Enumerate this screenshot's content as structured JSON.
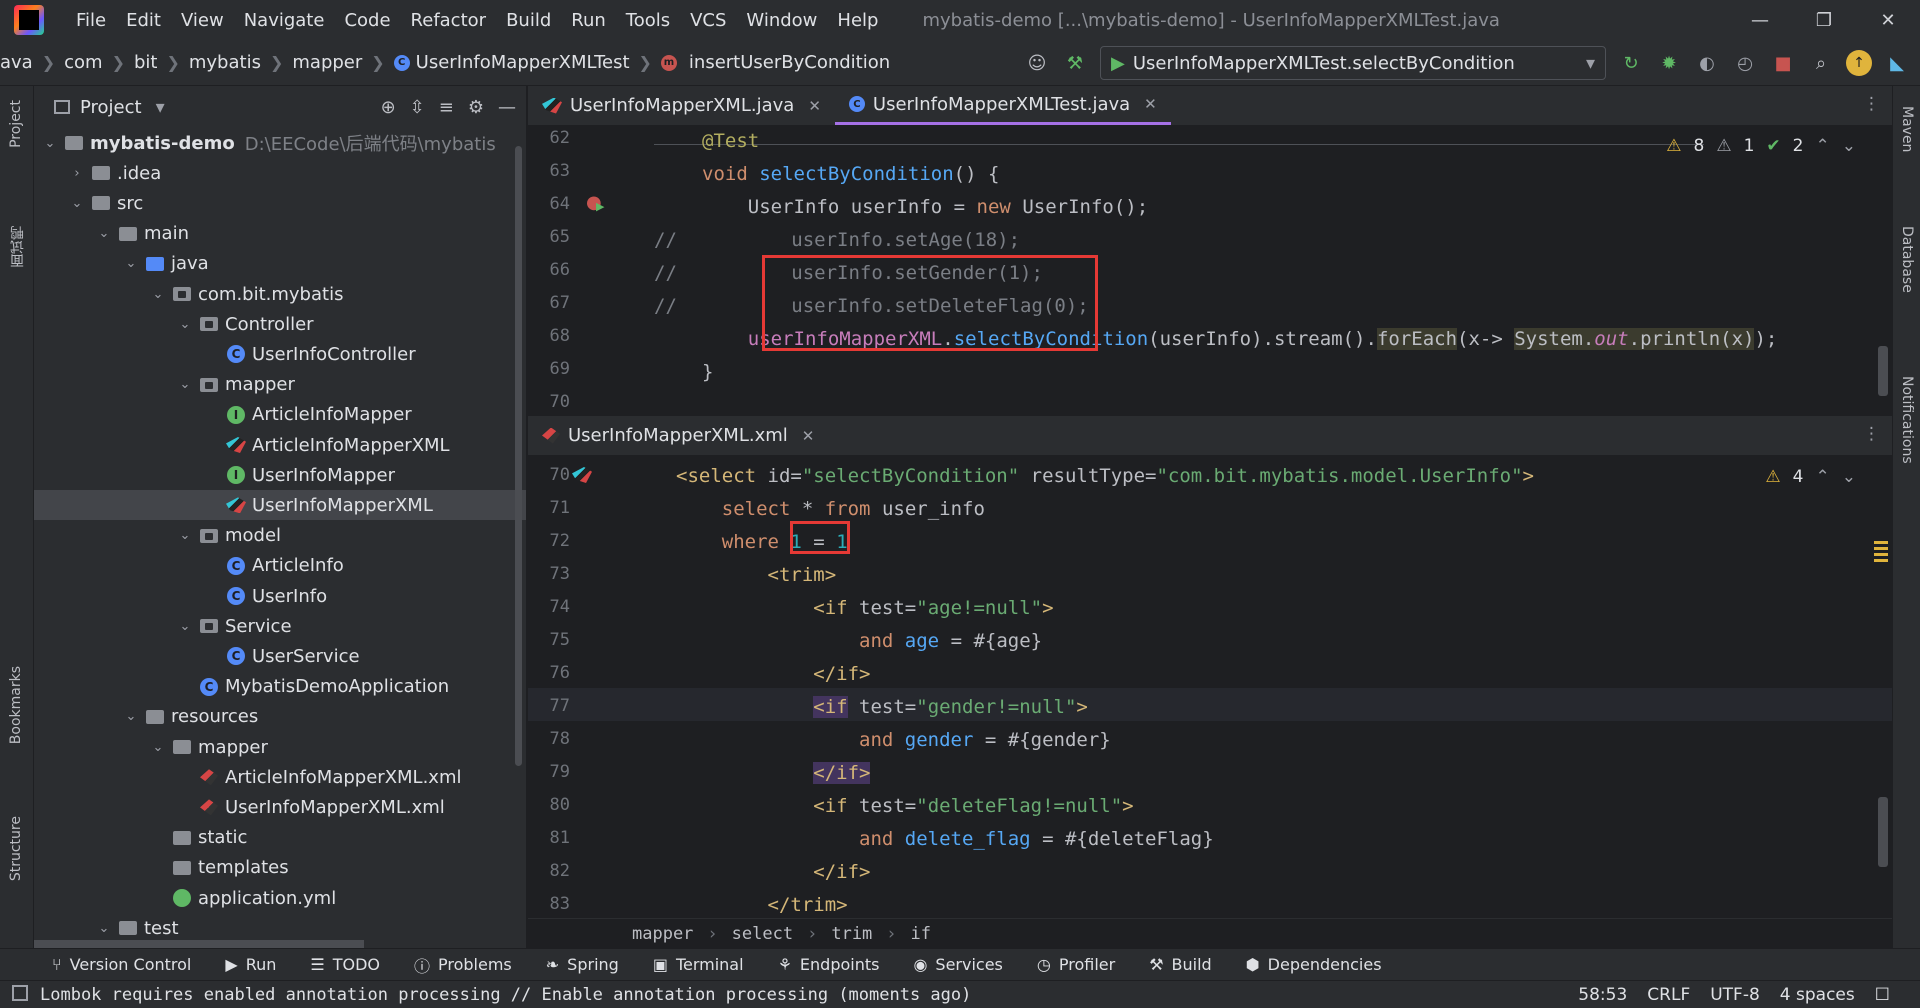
{
  "menu": [
    "File",
    "Edit",
    "View",
    "Navigate",
    "Code",
    "Refactor",
    "Build",
    "Run",
    "Tools",
    "VCS",
    "Window",
    "Help"
  ],
  "window_title": "mybatis-demo [...\\mybatis-demo] - UserInfoMapperXMLTest.java",
  "breadcrumbs": [
    "ava",
    "com",
    "bit",
    "mybatis",
    "mapper",
    "UserInfoMapperXMLTest",
    "insertUserByCondition"
  ],
  "run_config": "UserInfoMapperXMLTest.selectByCondition",
  "left_stripe": {
    "project": "Project",
    "chinese": "面试鸭",
    "bookmarks": "Bookmarks",
    "structure": "Structure"
  },
  "right_stripe": {
    "maven": "Maven",
    "database": "Database",
    "notifications": "Notifications"
  },
  "project_panel": {
    "title": "Project",
    "tree": [
      {
        "label": "mybatis-demo",
        "path": "D:\\EECode\\后端代码\\mybatis",
        "depth": 0,
        "arrow": "v",
        "icon": "folder",
        "bold": true
      },
      {
        "label": ".idea",
        "depth": 1,
        "arrow": ">",
        "icon": "folder"
      },
      {
        "label": "src",
        "depth": 1,
        "arrow": "v",
        "icon": "folder"
      },
      {
        "label": "main",
        "depth": 2,
        "arrow": "v",
        "icon": "folder"
      },
      {
        "label": "java",
        "depth": 3,
        "arrow": "v",
        "icon": "folder-blue"
      },
      {
        "label": "com.bit.mybatis",
        "depth": 4,
        "arrow": "v",
        "icon": "package"
      },
      {
        "label": "Controller",
        "depth": 5,
        "arrow": "v",
        "icon": "package"
      },
      {
        "label": "UserInfoController",
        "depth": 6,
        "arrow": "",
        "icon": "class"
      },
      {
        "label": "mapper",
        "depth": 5,
        "arrow": "v",
        "icon": "package"
      },
      {
        "label": "ArticleInfoMapper",
        "depth": 6,
        "arrow": "",
        "icon": "interface"
      },
      {
        "label": "ArticleInfoMapperXML",
        "depth": 6,
        "arrow": "",
        "icon": "mybatis"
      },
      {
        "label": "UserInfoMapper",
        "depth": 6,
        "arrow": "",
        "icon": "interface"
      },
      {
        "label": "UserInfoMapperXML",
        "depth": 6,
        "arrow": "",
        "icon": "mybatis",
        "selected": true
      },
      {
        "label": "model",
        "depth": 5,
        "arrow": "v",
        "icon": "package"
      },
      {
        "label": "ArticleInfo",
        "depth": 6,
        "arrow": "",
        "icon": "class"
      },
      {
        "label": "UserInfo",
        "depth": 6,
        "arrow": "",
        "icon": "class"
      },
      {
        "label": "Service",
        "depth": 5,
        "arrow": "v",
        "icon": "package"
      },
      {
        "label": "UserService",
        "depth": 6,
        "arrow": "",
        "icon": "class"
      },
      {
        "label": "MybatisDemoApplication",
        "depth": 5,
        "arrow": "",
        "icon": "class"
      },
      {
        "label": "resources",
        "depth": 3,
        "arrow": "v",
        "icon": "folder"
      },
      {
        "label": "mapper",
        "depth": 4,
        "arrow": "v",
        "icon": "folder"
      },
      {
        "label": "ArticleInfoMapperXML.xml",
        "depth": 5,
        "arrow": "",
        "icon": "xml"
      },
      {
        "label": "UserInfoMapperXML.xml",
        "depth": 5,
        "arrow": "",
        "icon": "xml"
      },
      {
        "label": "static",
        "depth": 4,
        "arrow": "",
        "icon": "folder"
      },
      {
        "label": "templates",
        "depth": 4,
        "arrow": "",
        "icon": "folder"
      },
      {
        "label": "application.yml",
        "depth": 4,
        "arrow": "",
        "icon": "yml"
      },
      {
        "label": "test",
        "depth": 2,
        "arrow": "v",
        "icon": "folder"
      }
    ]
  },
  "editor_top": {
    "tabs": [
      {
        "label": "UserInfoMapperXML.java",
        "active": false
      },
      {
        "label": "UserInfoMapperXMLTest.java",
        "active": true
      }
    ],
    "inspections": {
      "warnings": "8",
      "weak_warnings": "1",
      "ok": "2"
    },
    "line_numbers": [
      "62",
      "63",
      "64",
      "65",
      "66",
      "67",
      "68",
      "69",
      "70"
    ]
  },
  "editor_bottom": {
    "tab": "UserInfoMapperXML.xml",
    "inspections": {
      "warnings": "4"
    },
    "line_numbers": [
      "70",
      "71",
      "72",
      "73",
      "74",
      "75",
      "76",
      "77",
      "78",
      "79",
      "80",
      "81",
      "82",
      "83"
    ],
    "breadcrumb": [
      "mapper",
      "select",
      "trim",
      "if"
    ]
  },
  "tool_windows": [
    "Version Control",
    "Run",
    "TODO",
    "Problems",
    "Spring",
    "Terminal",
    "Endpoints",
    "Services",
    "Profiler",
    "Build",
    "Dependencies"
  ],
  "status": {
    "message": "Lombok requires enabled annotation processing // Enable annotation processing (moments ago)",
    "position": "58:53",
    "line_sep": "CRLF",
    "encoding": "UTF-8",
    "indent": "4 spaces"
  }
}
